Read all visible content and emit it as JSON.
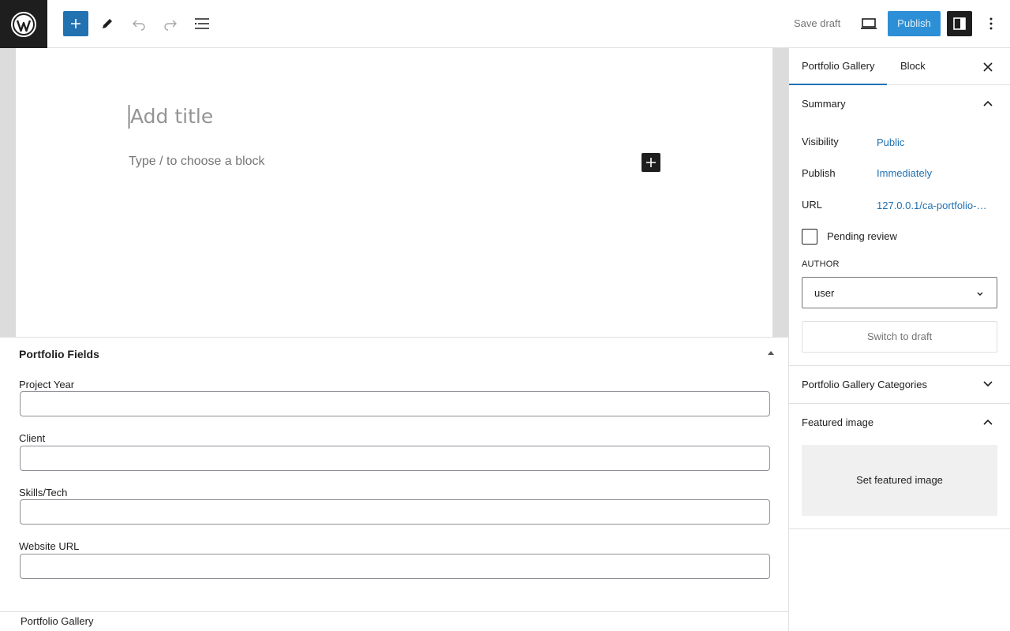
{
  "toolbar": {
    "save_draft": "Save draft",
    "publish": "Publish"
  },
  "editor": {
    "title_placeholder": "Add title",
    "block_placeholder": "Type / to choose a block"
  },
  "metabox": {
    "title": "Portfolio Fields",
    "fields": [
      {
        "label": "Project Year",
        "value": ""
      },
      {
        "label": "Client",
        "value": ""
      },
      {
        "label": "Skills/Tech",
        "value": ""
      },
      {
        "label": "Website URL",
        "value": ""
      }
    ]
  },
  "footer": {
    "breadcrumb": "Portfolio Gallery"
  },
  "sidebar": {
    "tabs": [
      "Portfolio Gallery",
      "Block"
    ],
    "summary": {
      "title": "Summary",
      "visibility_label": "Visibility",
      "visibility_value": "Public",
      "publish_label": "Publish",
      "publish_value": "Immediately",
      "url_label": "URL",
      "url_value": "127.0.0.1/ca-portfolio-…",
      "pending_review": "Pending review",
      "author_label": "AUTHOR",
      "author_value": "user",
      "switch_to_draft": "Switch to draft"
    },
    "categories_title": "Portfolio Gallery Categories",
    "featured_image": {
      "title": "Featured image",
      "button": "Set featured image"
    }
  },
  "colors": {
    "accent": "#2271b1",
    "publish_bg": "#2d8fd5",
    "dark": "#1e1e1e"
  },
  "icons": [
    "wordpress-logo-icon",
    "plus-icon",
    "pencil-icon",
    "undo-icon",
    "redo-icon",
    "list-view-icon",
    "desktop-preview-icon",
    "sidebar-toggle-icon",
    "more-vertical-icon",
    "close-icon",
    "chevron-up-icon",
    "chevron-down-icon"
  ]
}
